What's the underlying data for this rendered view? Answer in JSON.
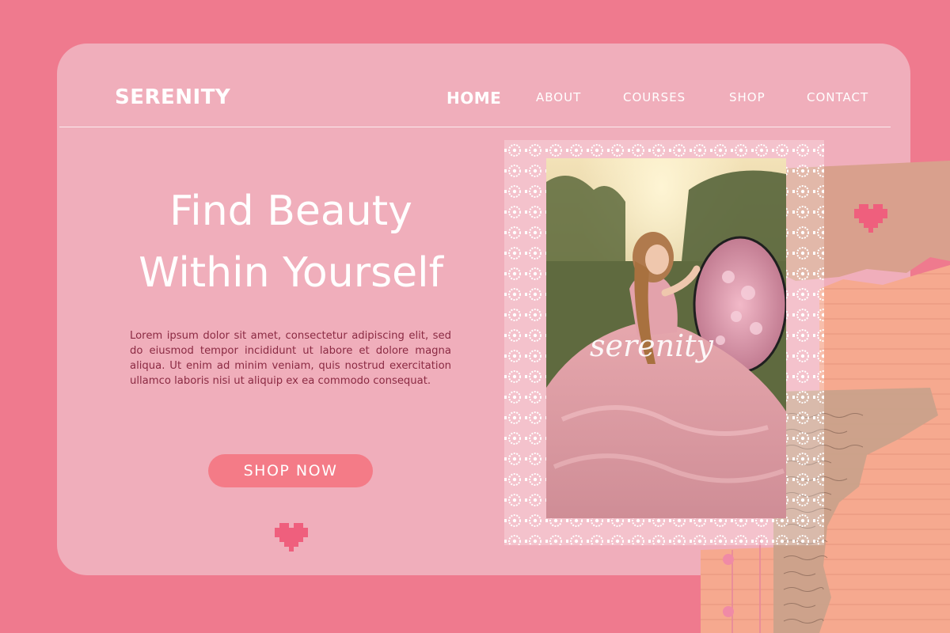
{
  "brand": "SERENITY",
  "nav": {
    "items": [
      {
        "label": "HOME",
        "active": true
      },
      {
        "label": "ABOUT",
        "active": false
      },
      {
        "label": "COURSES",
        "active": false
      },
      {
        "label": "SHOP",
        "active": false
      },
      {
        "label": "CONTACT",
        "active": false
      }
    ]
  },
  "hero": {
    "headline_line1": "Find Beauty",
    "headline_line2": "Within Yourself",
    "body": "Lorem ipsum dolor sit amet, consectetur adipiscing elit, sed do eiusmod tempor incididunt ut labore et dolore magna aliqua. Ut enim ad minim veniam, quis nostrud exercitation ullamco laboris nisi ut aliquip ex ea commodo consequat.",
    "cta_label": "SHOP NOW"
  },
  "photo": {
    "overlay_script": "serenity"
  },
  "colors": {
    "background": "#ef7a8e",
    "card": "#f0aebb",
    "button": "#f47b87",
    "body_text": "#8b2a43",
    "heart": "#ef5f7d",
    "paper": "#f6a98f"
  },
  "icons": [
    "pixel-heart-icon",
    "lace-frame"
  ]
}
